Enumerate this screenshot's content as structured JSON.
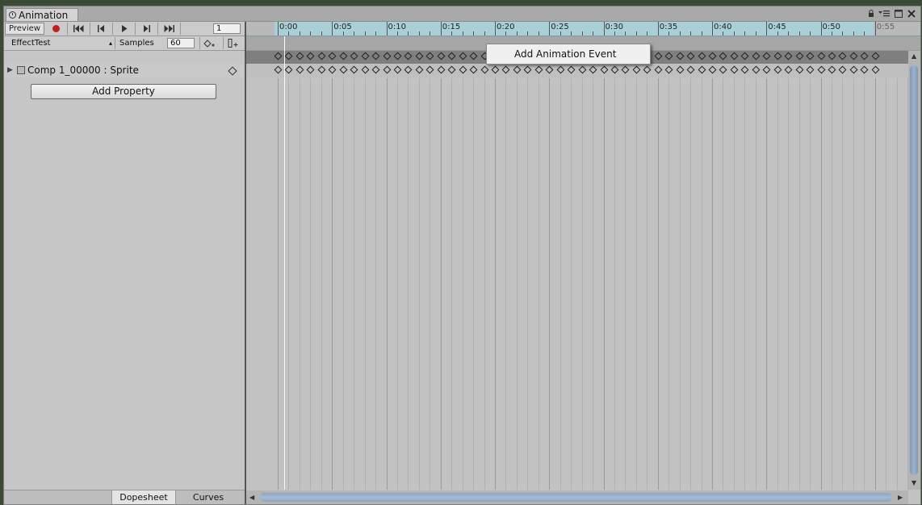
{
  "window": {
    "tab_title": "Animation"
  },
  "toolbar": {
    "preview_label": "Preview",
    "frame": "1"
  },
  "clip": {
    "name": "EffectTest",
    "samples_label": "Samples",
    "samples_value": "60"
  },
  "property": {
    "label": "Comp 1_00000 : Sprite"
  },
  "buttons": {
    "add_property": "Add Property"
  },
  "view_tabs": {
    "dopesheet": "Dopesheet",
    "curves": "Curves"
  },
  "timeline": {
    "labels": [
      "0:00",
      "0:05",
      "0:10",
      "0:15",
      "0:20",
      "0:25",
      "0:30",
      "0:35",
      "0:40",
      "0:45",
      "0:50",
      "0:55"
    ],
    "keyframe_count": 56
  },
  "context_menu": {
    "items": [
      "Add Animation Event"
    ]
  },
  "colors": {
    "ruler": "#a9d0d7",
    "record": "#c0201c",
    "scroll_thumb": "#9db3cf"
  }
}
